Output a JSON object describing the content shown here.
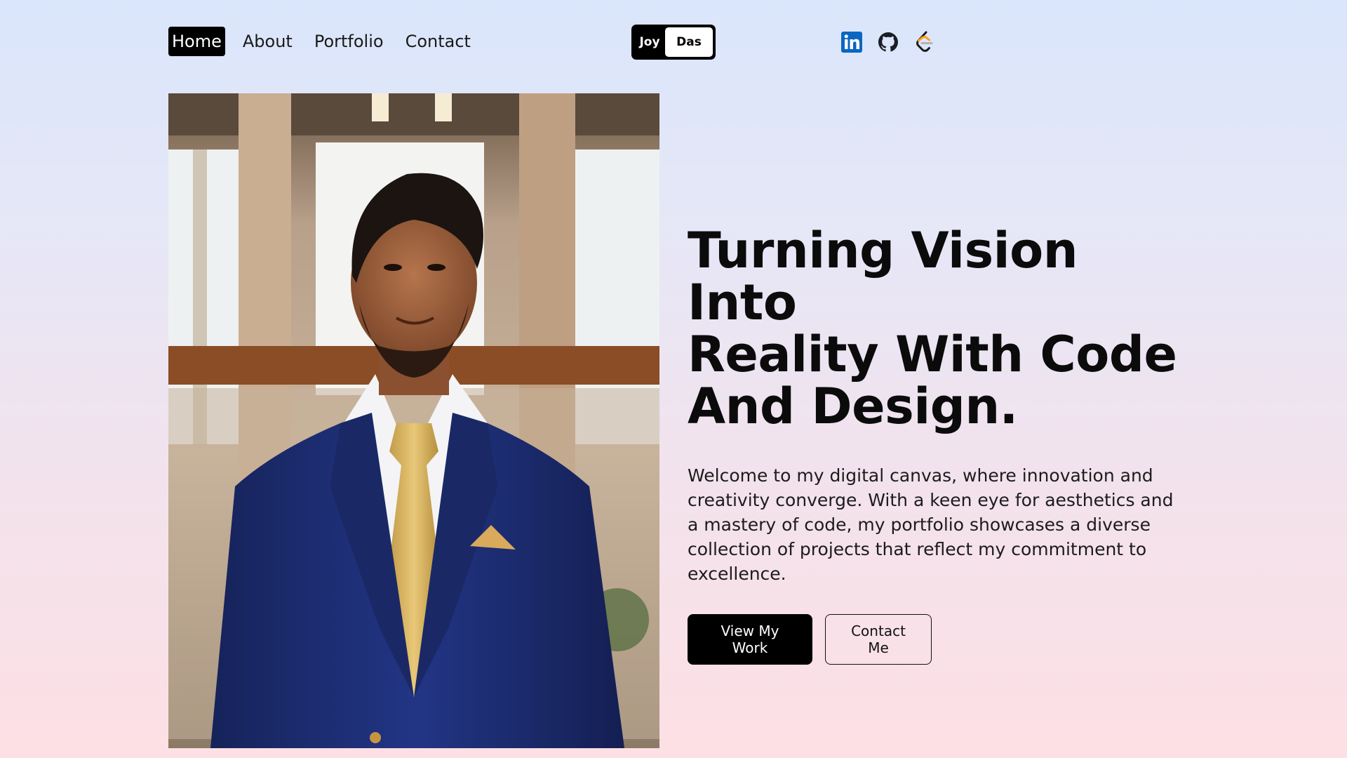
{
  "nav": {
    "items": [
      {
        "label": "Home",
        "active": true
      },
      {
        "label": "About",
        "active": false
      },
      {
        "label": "Portfolio",
        "active": false
      },
      {
        "label": "Contact",
        "active": false
      }
    ]
  },
  "logo": {
    "first": "Joy",
    "last": "Das"
  },
  "social": [
    {
      "icon": "linkedin-icon",
      "color": "#0a66c2"
    },
    {
      "icon": "github-icon",
      "color": "#1b1f23"
    },
    {
      "icon": "leetcode-icon",
      "color": "#ffa116"
    }
  ],
  "hero": {
    "title_line1": "Turning Vision Into",
    "title_line2": "Reality With Code",
    "title_line3": "And Design.",
    "description": "Welcome to my digital canvas, where innovation and creativity converge. With a keen eye for aesthetics and a mastery of code, my portfolio showcases a diverse collection of projects that reflect my commitment to excellence.",
    "primary_button": "View My Work",
    "secondary_button": "Contact Me"
  },
  "colors": {
    "accent": "#000000",
    "background_top": "#dae6fb",
    "background_bottom": "#fde0e4"
  }
}
